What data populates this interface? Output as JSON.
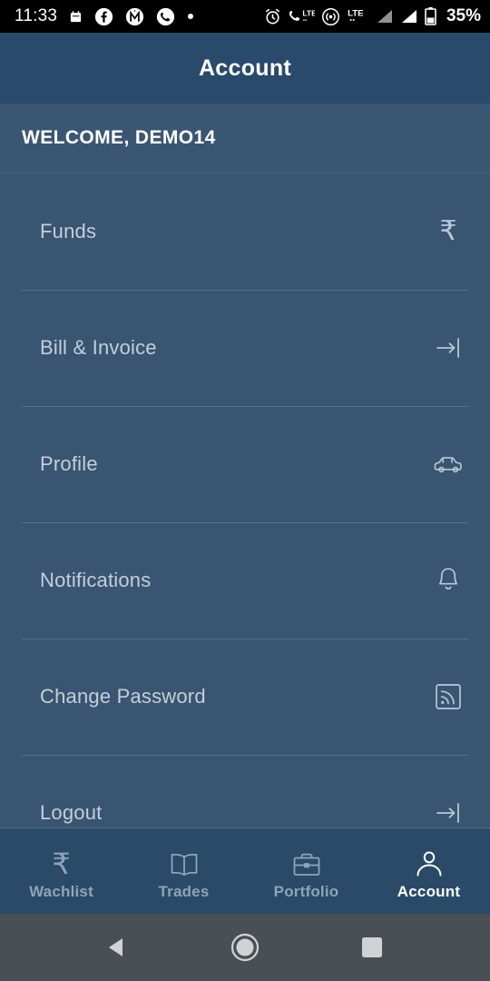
{
  "status_bar": {
    "time": "11:33",
    "battery": "35%",
    "left_icons": [
      "calendar-icon",
      "facebook-icon",
      "app-badge-icon",
      "whatsapp-icon",
      "dot-icon"
    ],
    "right_icons": [
      "alarm-icon",
      "call-lte-icon",
      "hotspot-icon",
      "lte-icon",
      "signal-bars-1-icon",
      "signal-bars-2-icon",
      "battery-icon"
    ]
  },
  "header": {
    "title": "Account"
  },
  "welcome": {
    "text": "WELCOME, DEMO14"
  },
  "menu": {
    "items": [
      {
        "label": "Funds",
        "icon": "rupee-icon"
      },
      {
        "label": "Bill & Invoice",
        "icon": "logout-arrow-icon"
      },
      {
        "label": "Profile",
        "icon": "car-icon"
      },
      {
        "label": "Notifications",
        "icon": "bell-icon"
      },
      {
        "label": "Change Password",
        "icon": "rss-feed-icon"
      },
      {
        "label": "Logout",
        "icon": "logout-arrow-icon"
      }
    ]
  },
  "bottom_nav": {
    "items": [
      {
        "label": "Wachlist",
        "icon": "rupee-icon",
        "active": false
      },
      {
        "label": "Trades",
        "icon": "book-icon",
        "active": false
      },
      {
        "label": "Portfolio",
        "icon": "briefcase-icon",
        "active": false
      },
      {
        "label": "Account",
        "icon": "person-icon",
        "active": true
      }
    ]
  },
  "android_nav": {
    "back": "back-triangle-icon",
    "home": "home-circle-icon",
    "recents": "recents-square-icon"
  },
  "colors": {
    "app_bar": "#2a4a6b",
    "welcome_bg": "#3a5673",
    "list_bg": "#395571",
    "bottom_nav_bg": "#2a4a68",
    "divider": "#52708c",
    "label": "#c3cfdb",
    "nav_inactive": "#8fa4b8",
    "nav_active": "#ffffff",
    "android_nav_bg": "#494f54",
    "status_bar_bg": "#000000"
  }
}
